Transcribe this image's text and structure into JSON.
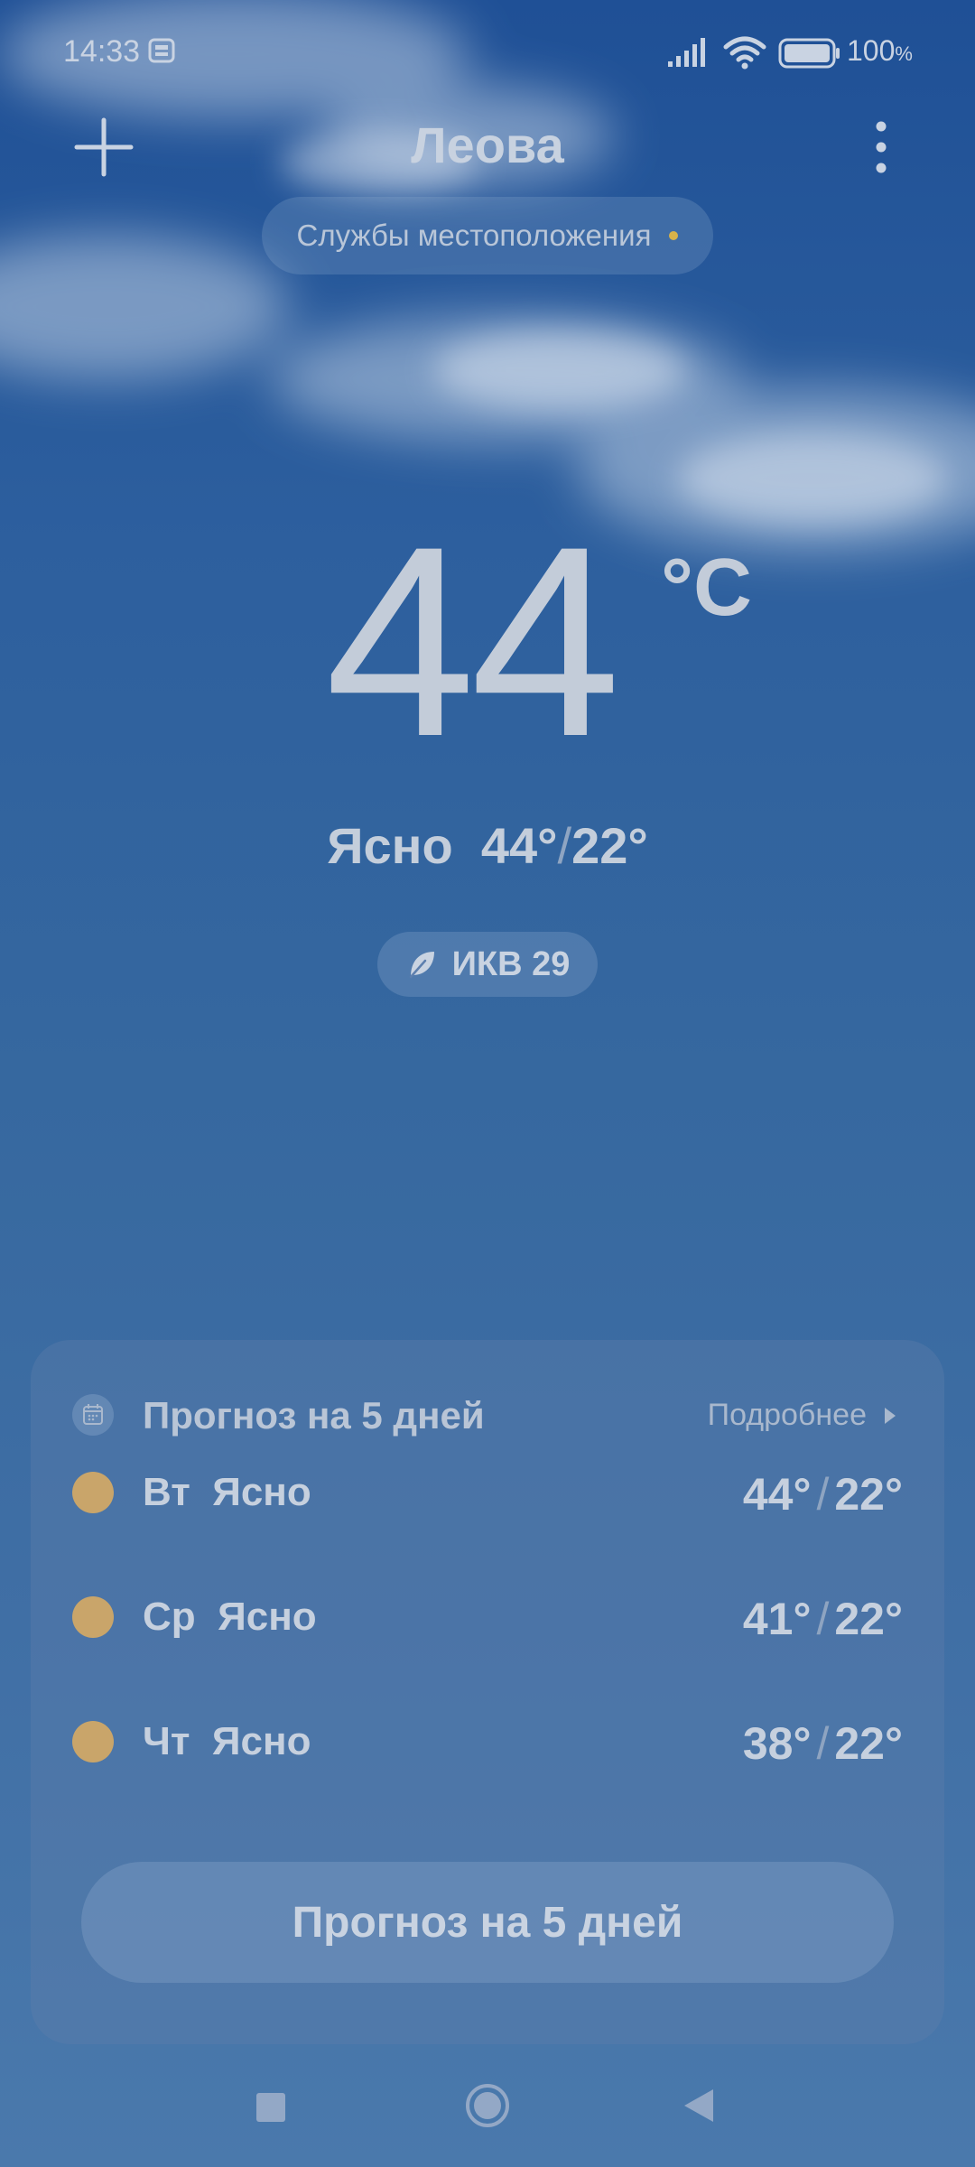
{
  "status_bar": {
    "time": "14:33",
    "left_icon": "notification-app-icon",
    "signal_icon": "cell-signal-icon",
    "wifi_icon": "wifi-icon",
    "battery_icon": "battery-icon",
    "battery_percent": "100",
    "battery_unit": "%"
  },
  "header": {
    "add_icon": "plus-icon",
    "city": "Леова",
    "menu_icon": "more-vertical-icon",
    "location_services": "Службы местоположения",
    "location_dot_color": "#d8b24a"
  },
  "current": {
    "temperature": "44",
    "unit": "°C",
    "condition": "Ясно",
    "high": "44°",
    "separator": "/",
    "low": "22°",
    "aqi_icon": "leaf-icon",
    "aqi_label": "ИКВ 29"
  },
  "forecast": {
    "calendar_icon": "calendar-icon",
    "title": "Прогноз на 5 дней",
    "more_label": "Подробнее",
    "more_icon": "chevron-right-icon",
    "days": [
      {
        "day": "Вт",
        "condition": "Ясно",
        "high": "44°",
        "low": "22°",
        "icon": "sun-icon"
      },
      {
        "day": "Ср",
        "condition": "Ясно",
        "high": "41°",
        "low": "22°",
        "icon": "sun-icon"
      },
      {
        "day": "Чт",
        "condition": "Ясно",
        "high": "38°",
        "low": "22°",
        "icon": "sun-icon"
      }
    ],
    "button_label": "Прогноз на 5 дней",
    "sun_color": "#c9a56a"
  },
  "nav_bar": {
    "recent_icon": "square-icon",
    "home_icon": "circle-home-icon",
    "back_icon": "triangle-back-icon"
  }
}
